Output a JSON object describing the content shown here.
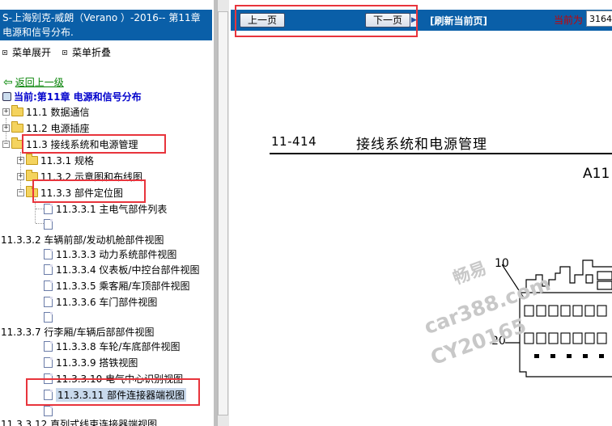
{
  "left_panel": {
    "title": "S-上海别克-威朗（Verano ）-2016-- 第11章 电源和信号分布.",
    "expand_all": "菜单展开",
    "collapse_all": "菜单折叠",
    "back_link": "返回上一级",
    "current": "当前:第11章 电源和信号分布",
    "tree": [
      {
        "label": "11.1 数据通信"
      },
      {
        "label": "11.2 电源插座"
      },
      {
        "label": "11.3 接线系统和电源管理"
      },
      {
        "label": "11.3.1 规格"
      },
      {
        "label": "11.3.2 示意图和布线图"
      },
      {
        "label": "11.3.3 部件定位图"
      },
      {
        "label": "11.3.3.1 主电气部件列表"
      },
      {
        "label": ""
      },
      {
        "label": "11.3.3.2 车辆前部/发动机舱部件视图"
      },
      {
        "label": "11.3.3.3 动力系统部件视图"
      },
      {
        "label": "11.3.3.4 仪表板/中控台部件视图"
      },
      {
        "label": "11.3.3.5 乘客厢/车顶部件视图"
      },
      {
        "label": "11.3.3.6 车门部件视图"
      },
      {
        "label": ""
      },
      {
        "label": "11.3.3.7 行李厢/车辆后部部件视图"
      },
      {
        "label": "11.3.3.8 车轮/车底部件视图"
      },
      {
        "label": "11.3.3.9 搭铁视图"
      },
      {
        "label": "11.3.3.10 电气中心识别视图"
      },
      {
        "label": "11.3.3.11 部件连接器端视图"
      },
      {
        "label": ""
      },
      {
        "label": "11.3.3.12 直列式线束连接器端视图"
      }
    ]
  },
  "toolbar": {
    "prev": "上一页",
    "next": "下一页",
    "refresh": "[刷新当前页]",
    "current_label": "当前为",
    "current_value": "3164"
  },
  "document": {
    "page_number": "11-414",
    "page_title": "接线系统和电源管理",
    "corner_code": "A11",
    "callout_10": "10",
    "callout_20": "20"
  },
  "watermark": {
    "line1": "畅易",
    "line2": "car388.com",
    "line3": "CY20165"
  },
  "colors": {
    "header_blue": "#0a5fa8",
    "annotation_red": "#e8343c",
    "link_green": "#008000"
  }
}
